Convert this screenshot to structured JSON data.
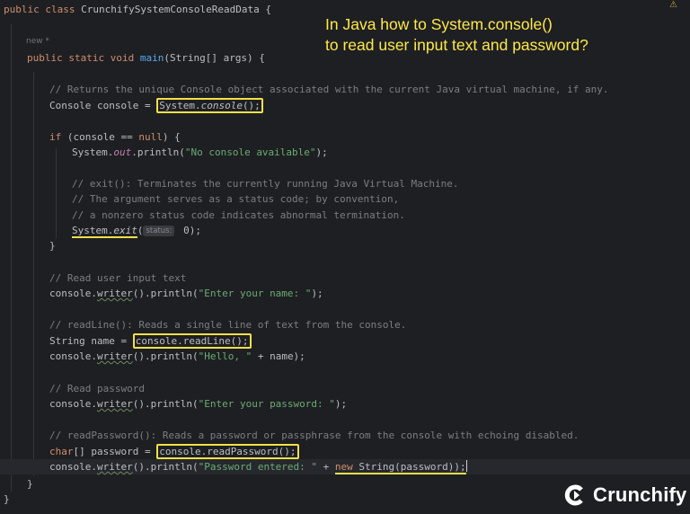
{
  "overlay": {
    "title_line1": "In Java how to System.console()",
    "title_line2": "to read user input text and password?",
    "brand": "Crunchify",
    "new_label": "new *",
    "warning_mark": "⚠"
  },
  "code": {
    "l1": {
      "kw": "public class ",
      "name": "CrunchifySystemConsoleReadData ",
      "tail": "{"
    },
    "l2": {
      "kw": "public static void ",
      "fn": "main",
      "tail": "(String[] args) {"
    },
    "l3": "// Returns the unique Console object associated with the current Java virtual machine, if any.",
    "l4": {
      "pre": "Console console = ",
      "boxed": "System.console()",
      "boxed_class": "System.",
      "boxed_method": "console",
      "boxed_tail": "();"
    },
    "l5": {
      "kw": "if ",
      "a": "(console == ",
      "kw2": "null",
      "b": ") {"
    },
    "l6": {
      "a": "System.",
      "field": "out",
      "b": ".println(",
      "str": "\"No console available\"",
      "c": ");"
    },
    "l7": "// exit(): Terminates the currently running Java Virtual Machine.",
    "l8": "// The argument serves as a status code; by convention,",
    "l9": "// a nonzero status code indicates abnormal termination.",
    "l10": {
      "a": "System.",
      "method": "exit",
      "b": "(",
      "hint": "status:",
      "c": " 0);"
    },
    "l11": "}",
    "l12": "// Read user input text",
    "l13": {
      "a": "console.",
      "method": "writer",
      "b": "().println(",
      "str": "\"Enter your name: \"",
      "c": ");"
    },
    "l14": "// readLine(): Reads a single line of text from the console.",
    "l15": {
      "a": "String name = ",
      "boxed": "console.readLine();"
    },
    "l16": {
      "a": "console.",
      "method": "writer",
      "b": "().println(",
      "str": "\"Hello, \"",
      "c": " + name);"
    },
    "l17": "// Read password",
    "l18": {
      "a": "console.",
      "method": "writer",
      "b": "().println(",
      "str": "\"Enter your password: \"",
      "c": ");"
    },
    "l19": "// readPassword(): Reads a password or passphrase from the console with echoing disabled.",
    "l20": {
      "kw": "char",
      "a": "[] password = ",
      "boxed": "console.readPassword();"
    },
    "l21": {
      "a": "console.",
      "method": "writer",
      "b": "().println(",
      "str": "\"Password entered: \"",
      "c": " + ",
      "kw": "new ",
      "d": "String(password));"
    },
    "l22": "}",
    "l23": "}"
  }
}
